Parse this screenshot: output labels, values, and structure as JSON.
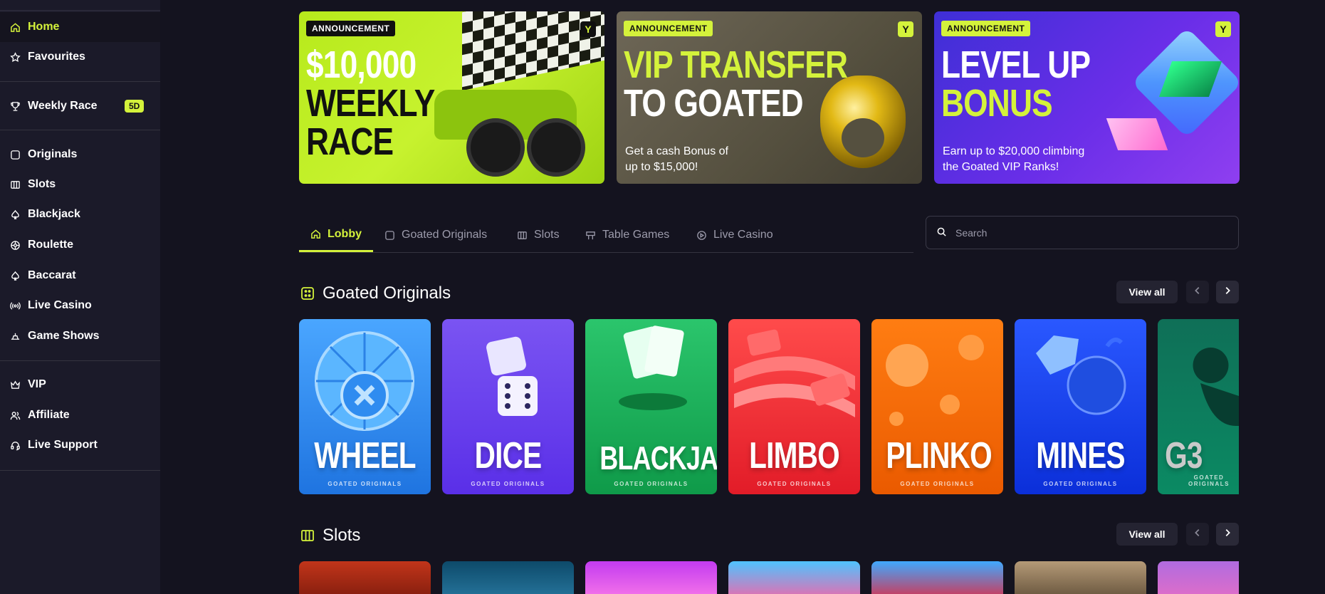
{
  "sidebar": {
    "items": [
      {
        "label": "Home",
        "icon": "home-icon",
        "active": true
      },
      {
        "label": "Favourites",
        "icon": "star-icon"
      },
      {
        "label": "Weekly Race",
        "icon": "trophy-icon",
        "badge": "5D"
      },
      {
        "label": "Originals",
        "icon": "originals-icon"
      },
      {
        "label": "Slots",
        "icon": "slots-icon"
      },
      {
        "label": "Blackjack",
        "icon": "spade-icon"
      },
      {
        "label": "Roulette",
        "icon": "roulette-icon"
      },
      {
        "label": "Baccarat",
        "icon": "club-icon"
      },
      {
        "label": "Live Casino",
        "icon": "broadcast-icon"
      },
      {
        "label": "Game Shows",
        "icon": "game-show-icon"
      },
      {
        "label": "VIP",
        "icon": "crown-icon"
      },
      {
        "label": "Affiliate",
        "icon": "users-icon"
      },
      {
        "label": "Live Support",
        "icon": "headset-icon"
      }
    ]
  },
  "banners": [
    {
      "tag": "ANNOUNCEMENT",
      "lines": [
        "$10,000",
        "WEEKLY",
        "RACE"
      ],
      "sub": []
    },
    {
      "tag": "ANNOUNCEMENT",
      "lines": [
        "VIP TRANSFER",
        "TO GOATED"
      ],
      "sub": [
        "Get a cash Bonus of",
        "up to $15,000!"
      ]
    },
    {
      "tag": "ANNOUNCEMENT",
      "lines": [
        "LEVEL UP",
        "BONUS"
      ],
      "sub": [
        "Earn up to $20,000 climbing",
        "the Goated VIP Ranks!"
      ]
    }
  ],
  "tabs": [
    {
      "label": "Lobby",
      "icon": "home-icon",
      "active": true
    },
    {
      "label": "Goated Originals",
      "icon": "originals-icon"
    },
    {
      "label": "Slots",
      "icon": "slots-icon"
    },
    {
      "label": "Table Games",
      "icon": "table-games-icon"
    },
    {
      "label": "Live Casino",
      "icon": "play-circle-icon"
    }
  ],
  "search": {
    "placeholder": "Search"
  },
  "sections": [
    {
      "title": "Goated Originals",
      "view_all": "View all"
    },
    {
      "title": "Slots",
      "view_all": "View all"
    }
  ],
  "originals": {
    "subtitle": "GOATED ORIGINALS",
    "cards": [
      "WHEEL",
      "DICE",
      "BLACKJACK",
      "LIMBO",
      "PLINKO",
      "MINES",
      "G3"
    ]
  },
  "colors": {
    "accent": "#d4f23b",
    "background": "#14131f",
    "sidebar": "#1b1a29"
  }
}
